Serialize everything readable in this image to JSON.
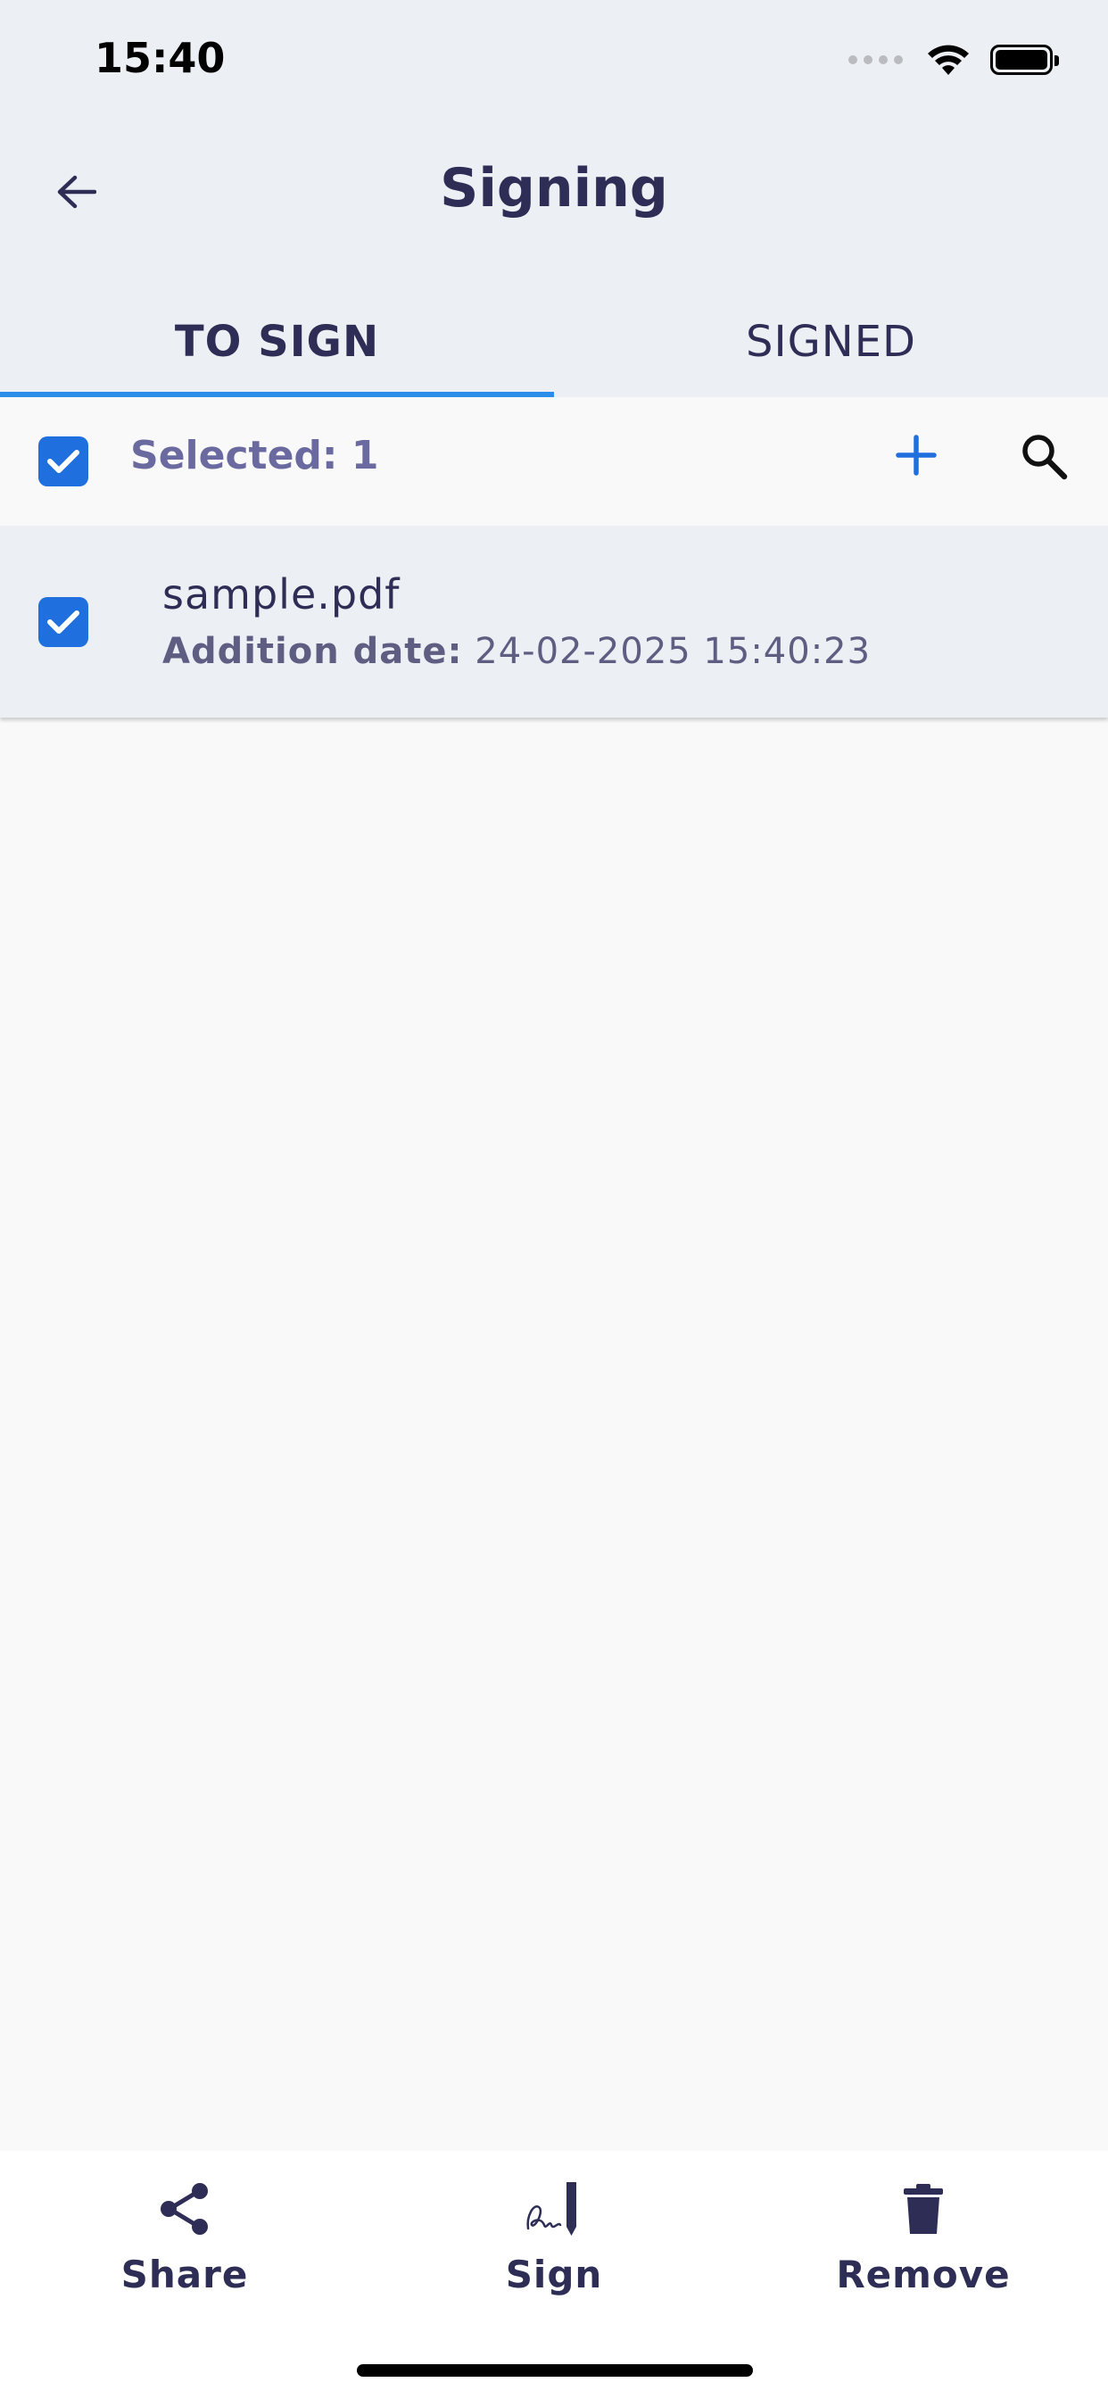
{
  "status_bar": {
    "time": "15:40"
  },
  "header": {
    "title": "Signing",
    "back_icon": "arrow-left-icon"
  },
  "tabs": [
    {
      "label": "TO SIGN",
      "active": true
    },
    {
      "label": "SIGNED",
      "active": false
    }
  ],
  "toolbar": {
    "select_all_checked": true,
    "selected_text": "Selected: 1",
    "add_icon": "plus-icon",
    "search_icon": "search-icon"
  },
  "files": [
    {
      "name": "sample.pdf",
      "date_label": "Addition date:",
      "date_value": "24-02-2025 15:40:23",
      "checked": true
    }
  ],
  "actions": [
    {
      "label": "Share",
      "icon": "share-icon"
    },
    {
      "label": "Sign",
      "icon": "signature-icon"
    },
    {
      "label": "Remove",
      "icon": "trash-icon"
    }
  ],
  "colors": {
    "accent": "#1f6fde",
    "tab_indicator": "#2a8de8",
    "header_bg": "#eceff3",
    "text_primary": "#2e2d55"
  }
}
